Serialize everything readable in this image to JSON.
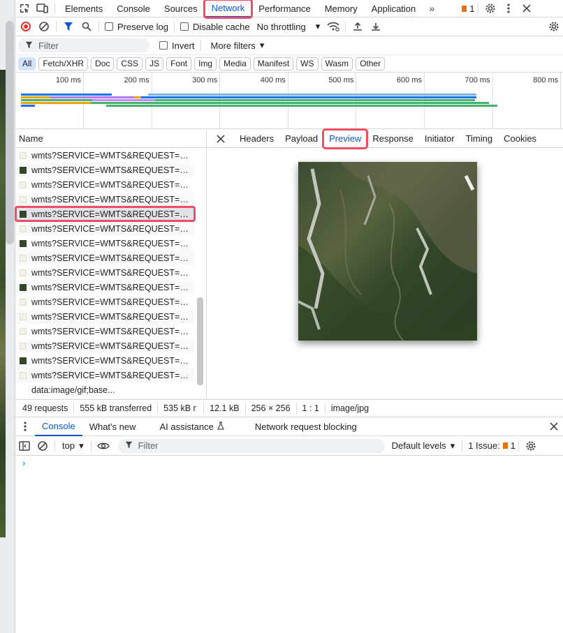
{
  "topbar": {
    "tabs": [
      "Elements",
      "Console",
      "Sources",
      "Network",
      "Performance",
      "Memory",
      "Application"
    ],
    "active_tab": "Network",
    "more": "»",
    "issues_count": "1"
  },
  "network_toolbar": {
    "preserve_log": "Preserve log",
    "disable_cache": "Disable cache",
    "throttling": "No throttling"
  },
  "filter_row": {
    "filter_placeholder": "Filter",
    "invert": "Invert",
    "more_filters": "More filters"
  },
  "type_chips": [
    "All",
    "Fetch/XHR",
    "Doc",
    "CSS",
    "JS",
    "Font",
    "Img",
    "Media",
    "Manifest",
    "WS",
    "Wasm",
    "Other"
  ],
  "overview": {
    "ticks": [
      "100 ms",
      "200 ms",
      "300 ms",
      "400 ms",
      "500 ms",
      "600 ms",
      "700 ms",
      "800 ms"
    ]
  },
  "request_list": {
    "header": "Name",
    "rows": [
      {
        "name": "wmts?SERVICE=WMTS&REQUEST=Ge...",
        "thumb": "light"
      },
      {
        "name": "wmts?SERVICE=WMTS&REQUEST=Ge...",
        "thumb": "dark"
      },
      {
        "name": "wmts?SERVICE=WMTS&REQUEST=Ge...",
        "thumb": "light"
      },
      {
        "name": "wmts?SERVICE=WMTS&REQUEST=Ge...",
        "thumb": "light"
      },
      {
        "name": "wmts?SERVICE=WMTS&REQUEST=Ge...",
        "thumb": "dark",
        "selected": true
      },
      {
        "name": "wmts?SERVICE=WMTS&REQUEST=Ge...",
        "thumb": "light"
      },
      {
        "name": "wmts?SERVICE=WMTS&REQUEST=Ge...",
        "thumb": "dark"
      },
      {
        "name": "wmts?SERVICE=WMTS&REQUEST=Ge...",
        "thumb": "light"
      },
      {
        "name": "wmts?SERVICE=WMTS&REQUEST=Ge...",
        "thumb": "light"
      },
      {
        "name": "wmts?SERVICE=WMTS&REQUEST=Ge...",
        "thumb": "dark"
      },
      {
        "name": "wmts?SERVICE=WMTS&REQUEST=Ge...",
        "thumb": "light"
      },
      {
        "name": "wmts?SERVICE=WMTS&REQUEST=Ge...",
        "thumb": "light"
      },
      {
        "name": "wmts?SERVICE=WMTS&REQUEST=Ge...",
        "thumb": "light"
      },
      {
        "name": "wmts?SERVICE=WMTS&REQUEST=Ge...",
        "thumb": "light"
      },
      {
        "name": "wmts?SERVICE=WMTS&REQUEST=Ge...",
        "thumb": "dark"
      },
      {
        "name": "wmts?SERVICE=WMTS&REQUEST=Ge...",
        "thumb": "light"
      },
      {
        "name": "data:image/gif;base...",
        "thumb": "none"
      }
    ]
  },
  "preview_tabs": [
    "Headers",
    "Payload",
    "Preview",
    "Response",
    "Initiator",
    "Timing",
    "Cookies"
  ],
  "preview_active": "Preview",
  "status": {
    "requests": "49 requests",
    "transferred": "555 kB transferred",
    "resources": "535 kB r",
    "size": "12.1 kB",
    "dimensions": "256 × 256",
    "ratio": "1 : 1",
    "mime": "image/jpg"
  },
  "drawer": {
    "tabs": [
      "Console",
      "What's new",
      "AI assistance",
      "Network request blocking"
    ],
    "context": "top",
    "filter_placeholder": "Filter",
    "levels": "Default levels",
    "issues_label": "1 Issue:",
    "issues_count": "1",
    "prompt": "›"
  },
  "colors": {
    "accent": "#0b57d0",
    "highlight": "#ee4d62"
  }
}
